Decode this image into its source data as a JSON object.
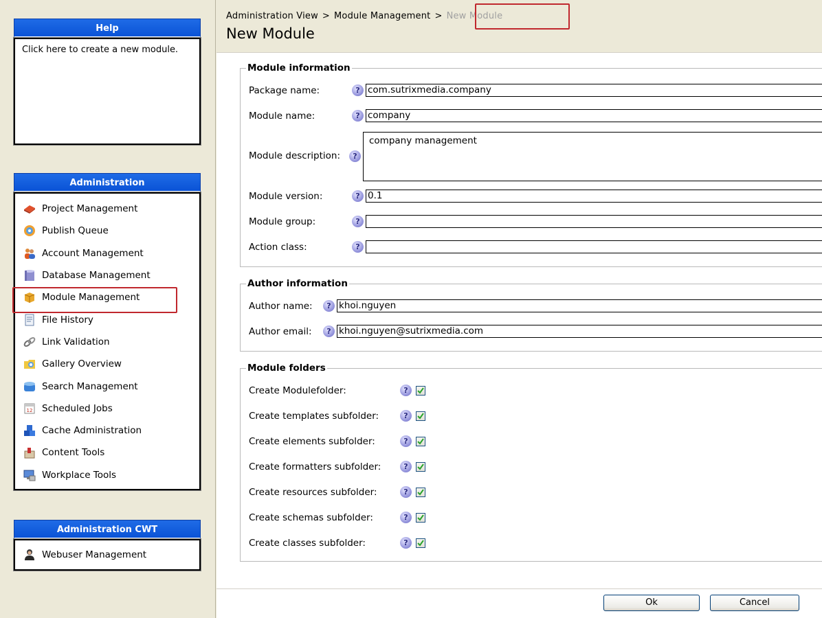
{
  "help": {
    "title": "Help",
    "text": "Click here to create a new module."
  },
  "administration": {
    "title": "Administration",
    "items": [
      {
        "label": "Project Management",
        "icon": "project-management-icon"
      },
      {
        "label": "Publish Queue",
        "icon": "publish-queue-icon"
      },
      {
        "label": "Account Management",
        "icon": "account-management-icon"
      },
      {
        "label": "Database Management",
        "icon": "database-icon"
      },
      {
        "label": "Module Management",
        "icon": "module-box-icon"
      },
      {
        "label": "File History",
        "icon": "file-history-icon"
      },
      {
        "label": "Link Validation",
        "icon": "link-icon"
      },
      {
        "label": "Gallery Overview",
        "icon": "gallery-icon"
      },
      {
        "label": "Search Management",
        "icon": "search-management-icon"
      },
      {
        "label": "Scheduled Jobs",
        "icon": "calendar-icon"
      },
      {
        "label": "Cache Administration",
        "icon": "cache-icon"
      },
      {
        "label": "Content Tools",
        "icon": "content-tools-icon"
      },
      {
        "label": "Workplace Tools",
        "icon": "workplace-tools-icon"
      }
    ]
  },
  "administration_cwt": {
    "title": "Administration CWT",
    "items": [
      {
        "label": "Webuser Management",
        "icon": "webuser-icon"
      }
    ]
  },
  "breadcrumb": {
    "items": [
      "Administration View",
      "Module Management",
      "New Module"
    ],
    "separator": ">"
  },
  "page_title": "New Module",
  "module_info": {
    "legend": "Module information",
    "package_label": "Package name:",
    "package_value": "com.sutrixmedia.company",
    "name_label": "Module name:",
    "name_value": "company",
    "description_label": "Module description:",
    "description_value": "company management",
    "version_label": "Module version:",
    "version_value": "0.1",
    "group_label": "Module group:",
    "group_value": "",
    "action_label": "Action class:",
    "action_value": ""
  },
  "author_info": {
    "legend": "Author information",
    "name_label": "Author name:",
    "name_value": "khoi.nguyen",
    "email_label": "Author email:",
    "email_value": "khoi.nguyen@sutrixmedia.com"
  },
  "module_folders": {
    "legend": "Module folders",
    "items": [
      {
        "label": "Create Modulefolder:",
        "checked": true
      },
      {
        "label": "Create templates subfolder:",
        "checked": true
      },
      {
        "label": "Create elements subfolder:",
        "checked": true
      },
      {
        "label": "Create formatters subfolder:",
        "checked": true
      },
      {
        "label": "Create resources subfolder:",
        "checked": true
      },
      {
        "label": "Create schemas subfolder:",
        "checked": true
      },
      {
        "label": "Create classes subfolder:",
        "checked": true
      }
    ]
  },
  "buttons": {
    "ok": "Ok",
    "cancel": "Cancel"
  },
  "colors": {
    "panel_header": "#0a53d6",
    "highlight": "#c0272d",
    "check": "#2aa32a"
  }
}
